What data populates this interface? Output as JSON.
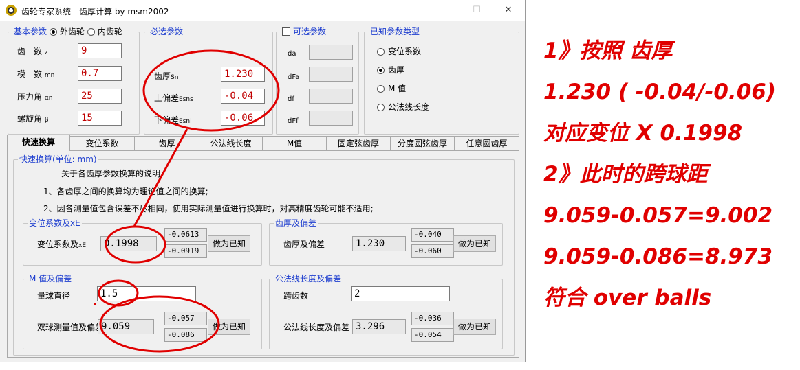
{
  "window": {
    "title": "齿轮专家系统—齿厚计算 by msm2002",
    "minimize": "—",
    "maximize": "☐",
    "close": "✕"
  },
  "basic": {
    "title": "基本参数",
    "external": "外齿轮",
    "internal": "内齿轮",
    "teeth_label": "齿　数",
    "teeth_sym": "z",
    "teeth": "9",
    "module_label": "模　数",
    "module_sym": "mn",
    "module": "0.7",
    "pressure_label": "压力角",
    "pressure_sym": "αn",
    "pressure": "25",
    "helix_label": "螺旋角",
    "helix_sym": "β",
    "helix": "15"
  },
  "required": {
    "title": "必选参数",
    "sn_label": "齿厚",
    "sn_sym": "Sn",
    "sn": "1.230",
    "esns_label": "上偏差",
    "esns_sym": "Esns",
    "esns": "-0.04",
    "esni_label": "下偏差",
    "esni_sym": "Esni",
    "esni": "-0.06"
  },
  "optional": {
    "title": "可选参数",
    "da": "da",
    "dfa": "dFa",
    "df": "df",
    "dff": "dFf"
  },
  "known_type": {
    "title": "已知参数类型",
    "options": [
      "变位系数",
      "齿厚",
      "M 值",
      "公法线长度"
    ],
    "selected": 1
  },
  "tabs": [
    "快速换算",
    "变位系数",
    "齿厚",
    "公法线长度",
    "M值",
    "固定弦齿厚",
    "分度圆弦齿厚",
    "任意圆齿厚"
  ],
  "quick": {
    "title": "快速换算(单位: mm)",
    "note_title": "关于各齿厚参数换算的说明",
    "note1": "1、各齿厚之间的换算均为理论值之间的换算;",
    "note2": "2、因各测量值包含误差不尽相同，使用实际测量值进行换算时，对高精度齿轮可能不适用;"
  },
  "shift": {
    "title": "变位系数及xE",
    "label": "变位系数及",
    "label_sym": "xE",
    "value": "0.1998",
    "dev_upper": "-0.0613",
    "dev_lower": "-0.0919",
    "button": "做为已知"
  },
  "thick": {
    "title": "齿厚及偏差",
    "label": "齿厚及偏差",
    "value": "1.230",
    "dev_upper": "-0.040",
    "dev_lower": "-0.060",
    "button": "做为已知"
  },
  "mvalue": {
    "title": "M 值及偏差",
    "ball_label": "量球直径",
    "ball": "1.5",
    "label": "双球测量值及偏差",
    "value": "9.059",
    "dev_upper": "-0.057",
    "dev_lower": "-0.086",
    "button": "做为已知"
  },
  "wlen": {
    "title": "公法线长度及偏差",
    "span_label": "跨齿数",
    "span": "2",
    "label": "公法线长度及偏差",
    "value": "3.296",
    "dev_upper": "-0.036",
    "dev_lower": "-0.054",
    "button": "做为已知"
  },
  "annotations": [
    "1》按照 齿厚",
    "1.230 ( -0.04/-0.06)",
    "对应变位 X 0.1998",
    "2》此时的跨球距",
    "9.059-0.057=9.002",
    "9.059-0.086=8.973",
    "符合 over balls"
  ],
  "colors": {
    "accent": "#1f3fcf",
    "value_red": "#c00000",
    "marker": "#e00000"
  }
}
